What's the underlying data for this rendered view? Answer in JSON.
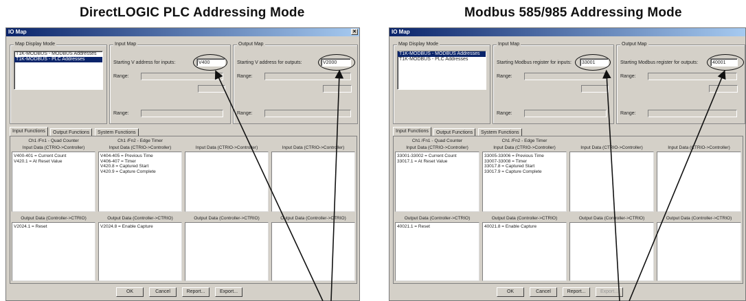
{
  "headers": {
    "left": "DirectLOGIC PLC Addressing Mode",
    "right": "Modbus 585/985 Addressing Mode"
  },
  "panels": [
    {
      "title": "IO Map",
      "map_display_label": "Map Display Mode",
      "map_modes": [
        "T1K-MODBUS - MODBUS Addresses",
        "T1K-MODBUS - PLC Addresses"
      ],
      "selected_mode": 1,
      "input_map_label": "Input Map",
      "input_start_label": "Starting V address for inputs:",
      "input_start_value": "V400",
      "range_label": "Range:",
      "output_map_label": "Output Map",
      "output_start_label": "Starting V address for outputs:",
      "output_start_value": "V2000",
      "tabs": [
        "Input Functions",
        "Output Functions",
        "System Functions"
      ],
      "col_headers": [
        "Ch1 /Fn1 - Quad Counter",
        "Ch1 /Fn2 - Edge Timer",
        "",
        ""
      ],
      "input_headers": [
        "Input Data (CTRIO->Controller)",
        "Input Data (CTRIO->Controller)",
        "Input Data (CTRIO->Controller)",
        "Input Data (CTRIO->Controller)"
      ],
      "input_cells": [
        "V400-401 = Current Count\nV420.1 = At Reset Value",
        "V404-405 = Previous Time\nV406-407 = Timer\nV420.8 = Captured Start\nV420.9 = Capture Complete",
        "",
        ""
      ],
      "output_headers": [
        "Output Data (Controller->CTRIO)",
        "Output Data (Controller->CTRIO)",
        "Output Data (Controller->CTRIO)",
        "Output Data (Controller->CTRIO)"
      ],
      "output_cells": [
        "V2024.1 = Reset",
        "V2024.8 = Enable Capture",
        "",
        ""
      ],
      "buttons": [
        "OK",
        "Cancel",
        "Report...",
        "Export..."
      ]
    },
    {
      "title": "IO Map",
      "map_display_label": "Map Display Mode",
      "map_modes": [
        "T1K-MODBUS - MODBUS Addresses",
        "T1K-MODBUS - PLC Addresses"
      ],
      "selected_mode": 0,
      "input_map_label": "Input Map",
      "input_start_label": "Starting Modbus register for inputs:",
      "input_start_value": "33001",
      "range_label": "Range:",
      "output_map_label": "Output Map",
      "output_start_label": "Starting Modbus register for outputs:",
      "output_start_value": "40001",
      "tabs": [
        "Input Functions",
        "Output Functions",
        "System Functions"
      ],
      "col_headers": [
        "Ch1 /Fn1 - Quad Counter",
        "Ch1 /Fn2 - Edge Timer",
        "",
        ""
      ],
      "input_headers": [
        "Input Data (CTRIO->Controller)",
        "Input Data (CTRIO->Controller)",
        "Input Data (CTRIO->Controller)",
        "Input Data (CTRIO->Controller)"
      ],
      "input_cells": [
        "33001-33002 = Current Count\n33017.1 = At Reset Value",
        "33005-33006 = Previous Time\n33007-33008 = Timer\n33017.8 = Captured Start\n33017.9 = Capture Complete",
        "",
        ""
      ],
      "output_headers": [
        "Output Data (Controller->CTRIO)",
        "Output Data (Controller->CTRIO)",
        "Output Data (Controller->CTRIO)",
        "Output Data (Controller->CTRIO)"
      ],
      "output_cells": [
        "40021.1 = Reset",
        "40021.8 = Enable Capture",
        "",
        ""
      ],
      "buttons": [
        "OK",
        "Cancel",
        "Report...",
        "Export..."
      ]
    }
  ],
  "icons": {
    "close": "close-icon",
    "arrow": "callout-arrow-icon"
  },
  "colors": {
    "titlebar": "#0a246a",
    "window": "#d4d0c8",
    "selection": "#0a246a"
  }
}
